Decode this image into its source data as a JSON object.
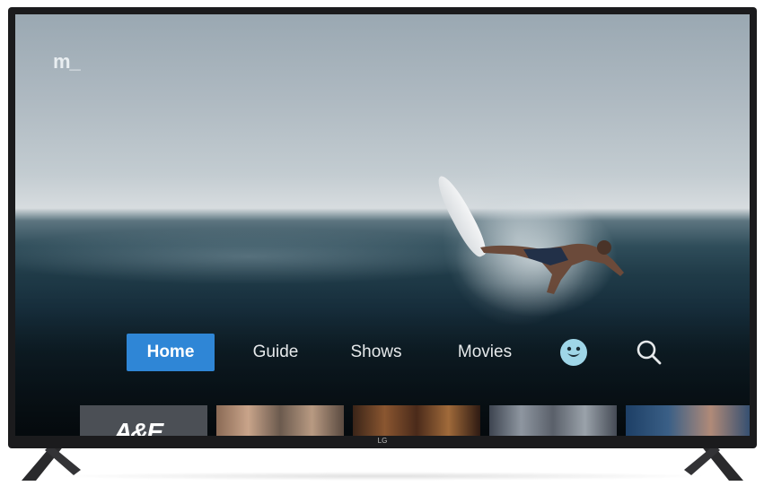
{
  "app": {
    "logo_text": "m_"
  },
  "nav": {
    "items": [
      {
        "label": "Home",
        "active": true
      },
      {
        "label": "Guide",
        "active": false
      },
      {
        "label": "Shows",
        "active": false
      },
      {
        "label": "Movies",
        "active": false
      }
    ],
    "icons": [
      "kids-mascot-icon",
      "search-icon"
    ]
  },
  "carousel": {
    "items": [
      {
        "label": "A&E",
        "icon": "ae-channel-logo"
      },
      {
        "label": "",
        "icon": "cast-group-photo"
      },
      {
        "label": "",
        "icon": "dramatic-scene-photo"
      },
      {
        "label": "",
        "icon": "cast-lineup-photo"
      },
      {
        "label": "",
        "icon": "host-portrait-photo"
      }
    ]
  },
  "tv": {
    "brand": "LG"
  },
  "colors": {
    "accent": "#2f86d6",
    "nav_text": "#e6e9eb",
    "mascot": "#9fd6e8",
    "frame": "#1b1b1d"
  }
}
